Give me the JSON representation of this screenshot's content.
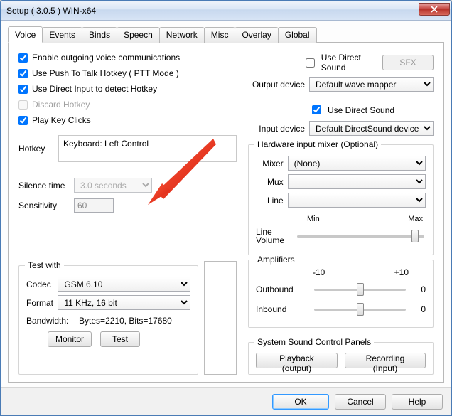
{
  "window": {
    "title": "Setup ( 3.0.5 ) WIN-x64"
  },
  "tabs": {
    "items": [
      "Voice",
      "Events",
      "Binds",
      "Speech",
      "Network",
      "Misc",
      "Overlay",
      "Global"
    ],
    "active": 0
  },
  "left": {
    "chk_outgoing": {
      "checked": true,
      "label": "Enable outgoing voice communications"
    },
    "chk_ptt": {
      "checked": true,
      "label": "Use Push To Talk Hotkey ( PTT Mode )"
    },
    "chk_dinput": {
      "checked": true,
      "label": "Use Direct Input to detect Hotkey"
    },
    "chk_discard": {
      "checked": false,
      "label": "Discard Hotkey",
      "disabled": true
    },
    "chk_clicks": {
      "checked": true,
      "label": "Play Key Clicks"
    },
    "hotkey_label": "Hotkey",
    "hotkey_value": "Keyboard: Left Control",
    "silence_label": "Silence time",
    "silence_value": "3.0 seconds",
    "sensitivity_label": "Sensitivity",
    "sensitivity_value": "60",
    "test_group_title": "Test with",
    "codec_label": "Codec",
    "codec_value": "GSM 6.10",
    "format_label": "Format",
    "format_value": "11 KHz, 16 bit",
    "bandwidth_label": "Bandwidth:",
    "bandwidth_value": "Bytes=2210, Bits=17680",
    "monitor_btn": "Monitor",
    "test_btn": "Test"
  },
  "right": {
    "sfx_btn": "SFX",
    "out_direct_chk": {
      "checked": false,
      "label": "Use Direct Sound"
    },
    "out_label": "Output device",
    "out_value": "Default wave mapper",
    "in_direct_chk": {
      "checked": true,
      "label": "Use Direct Sound"
    },
    "in_label": "Input device",
    "in_value": "Default DirectSound device",
    "mixer_group_title": "Hardware input mixer (Optional)",
    "mixer_label": "Mixer",
    "mixer_value": "(None)",
    "mux_label": "Mux",
    "line_label": "Line",
    "vol_label": "Line Volume",
    "min_label": "Min",
    "max_label": "Max",
    "vol_value": 95,
    "amp_group_title": "Amplifiers",
    "amp_min": "-10",
    "amp_max": "+10",
    "amp_out_label": "Outbound",
    "amp_out_value": 0,
    "amp_out_display": "0",
    "amp_in_label": "Inbound",
    "amp_in_value": 0,
    "amp_in_display": "0",
    "syspanels_title": "System Sound Control Panels",
    "playback_btn": "Playback (output)",
    "recording_btn": "Recording (Input)"
  },
  "footer": {
    "ok": "OK",
    "cancel": "Cancel",
    "help": "Help"
  }
}
